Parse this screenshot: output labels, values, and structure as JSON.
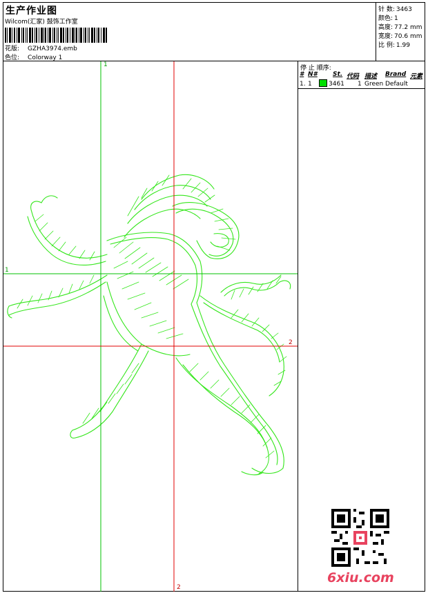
{
  "header": {
    "title": "生产作业图",
    "subtitle": "Wilcom(汇家) 鼓饰工作室",
    "design_label": "花版:",
    "design_value": "GZHA3974.emb",
    "colorway_label": "色位:",
    "colorway_value": "Colorway 1"
  },
  "stats": [
    {
      "label": "针 数:",
      "value": "3463"
    },
    {
      "label": "颜色:",
      "value": "1"
    },
    {
      "label": "高度:",
      "value": "77.2 mm"
    },
    {
      "label": "宽度:",
      "value": "70.6 mm"
    },
    {
      "label": "比 例:",
      "value": "1.99"
    }
  ],
  "guides": {
    "green_vertical": "1",
    "green_horizontal": "1",
    "red_vertical": "2",
    "red_horizontal": "2"
  },
  "legend": {
    "title": "停 止 顺序:",
    "headers": [
      "#",
      "N#",
      "St.",
      "代码",
      "描述",
      "Brand",
      "元素"
    ],
    "rows": [
      {
        "index": "1.",
        "n": "1",
        "stitches": "3461",
        "code": "1",
        "description": "Green",
        "brand": "Default",
        "color": "#00e000"
      }
    ]
  },
  "watermark": "6xiu.com",
  "colors": {
    "stitch": "#33e61a",
    "guide_green": "#00c000",
    "guide_red": "#e00000",
    "watermark": "#e8435f"
  }
}
